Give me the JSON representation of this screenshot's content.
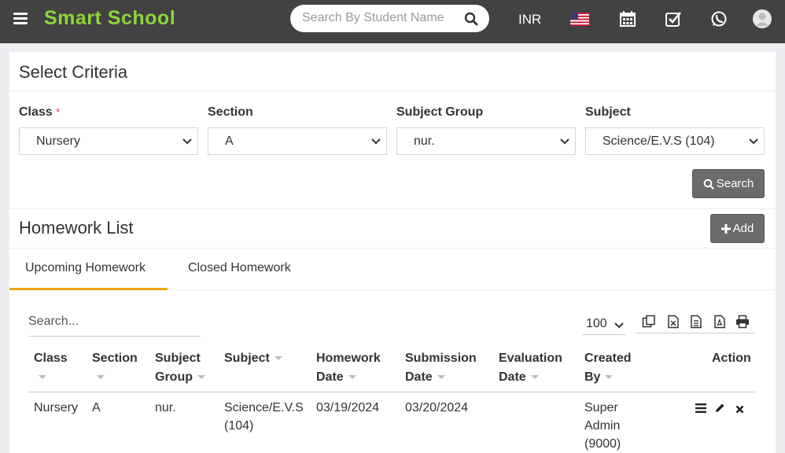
{
  "topbar": {
    "brand": "Smart School",
    "search_placeholder": "Search By Student Name",
    "currency": "INR",
    "icons": [
      "menu-icon",
      "search-icon",
      "us-flag-icon",
      "calendar-icon",
      "checkbox-icon",
      "whatsapp-icon",
      "user-avatar-icon"
    ]
  },
  "criteria": {
    "title": "Select Criteria",
    "fields": [
      {
        "label": "Class",
        "required_mark": "*",
        "value": "Nursery"
      },
      {
        "label": "Section",
        "value": "A"
      },
      {
        "label": "Subject Group",
        "value": "nur."
      },
      {
        "label": "Subject",
        "value": "Science/E.V.S (104)"
      }
    ],
    "search_button": "Search"
  },
  "homework": {
    "title": "Homework List",
    "add_button": "Add",
    "tabs": [
      "Upcoming Homework",
      "Closed Homework"
    ],
    "active_tab": "Upcoming Homework",
    "table_search_placeholder": "Search...",
    "page_size": "100",
    "export_icons": [
      "copy-icon",
      "excel-icon",
      "csv-icon",
      "pdf-icon",
      "print-icon"
    ],
    "columns": [
      {
        "line1": "Class",
        "line2": ""
      },
      {
        "line1": "Section",
        "line2": ""
      },
      {
        "line1": "Subject",
        "line2": "Group"
      },
      {
        "line1": "Subject",
        "line2": ""
      },
      {
        "line1": "Homework",
        "line2": "Date"
      },
      {
        "line1": "Submission",
        "line2": "Date"
      },
      {
        "line1": "Evaluation",
        "line2": "Date"
      },
      {
        "line1": "Created",
        "line2": "By"
      },
      {
        "line1": "Action",
        "line2": ""
      }
    ],
    "rows": [
      {
        "class": "Nursery",
        "section": "A",
        "subject_group": "nur.",
        "subject_l1": "Science/E.V.S",
        "subject_l2": "(104)",
        "homework_date": "03/19/2024",
        "submission_date": "03/20/2024",
        "evaluation_date": "",
        "created_by_l1": "Super",
        "created_by_l2": "Admin",
        "created_by_l3": "(9000)"
      }
    ]
  },
  "colors": {
    "topbar": "#424242",
    "brand": "#8fd43a",
    "tab_accent": "#f0a30a",
    "button": "#6b6b6b"
  }
}
